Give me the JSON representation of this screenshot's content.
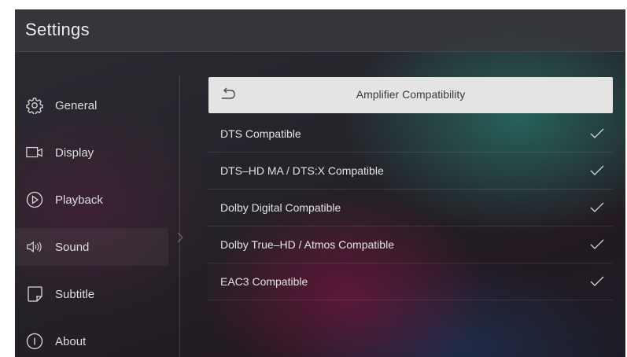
{
  "header": {
    "title": "Settings"
  },
  "sidebar": {
    "items": [
      {
        "label": "General",
        "icon": "gear-icon"
      },
      {
        "label": "Display",
        "icon": "display-icon"
      },
      {
        "label": "Playback",
        "icon": "play-circle-icon"
      },
      {
        "label": "Sound",
        "icon": "speaker-icon",
        "active": true
      },
      {
        "label": "Subtitle",
        "icon": "subtitle-icon"
      },
      {
        "label": "About",
        "icon": "info-icon"
      }
    ]
  },
  "panel": {
    "header_label": "Amplifier Compatibility",
    "options": [
      {
        "label": "DTS Compatible",
        "checked": true
      },
      {
        "label": "DTS–HD MA / DTS:X Compatible",
        "checked": true
      },
      {
        "label": "Dolby Digital Compatible",
        "checked": true
      },
      {
        "label": "Dolby True–HD / Atmos Compatible",
        "checked": true
      },
      {
        "label": "EAC3 Compatible",
        "checked": true
      }
    ]
  },
  "colors": {
    "header_row_bg": "#e4e4e4",
    "text": "#e3e3e3",
    "titlebar_bg": "#37373c"
  }
}
